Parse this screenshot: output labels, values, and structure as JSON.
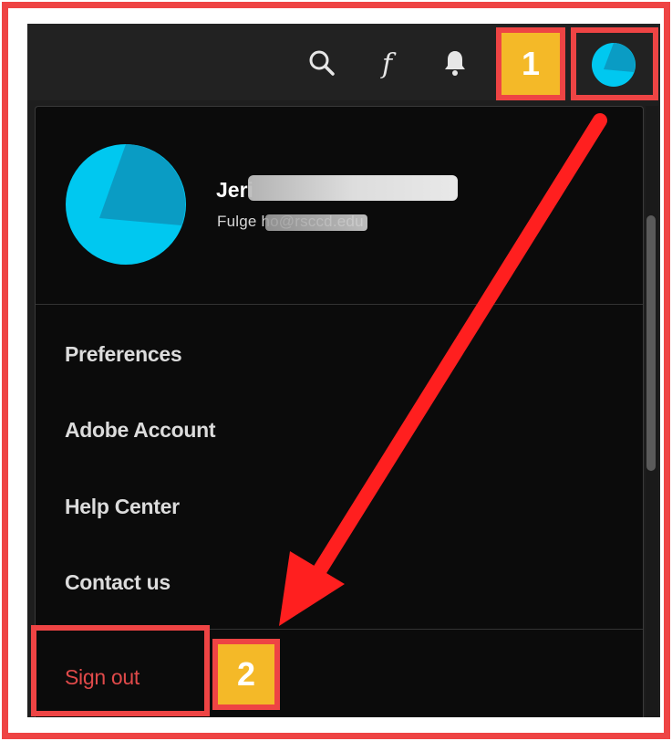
{
  "user": {
    "name": "Jeri",
    "email": "Fulge       ho@rsccd.edu"
  },
  "menu": {
    "items": [
      {
        "label": "Preferences"
      },
      {
        "label": "Adobe Account"
      },
      {
        "label": "Help Center"
      },
      {
        "label": "Contact us"
      }
    ],
    "signout_label": "Sign out"
  },
  "annotations": {
    "step1": "1",
    "step2": "2"
  },
  "toolbar": {
    "icons": [
      "search-icon",
      "font-icon",
      "bell-icon",
      "profile-avatar-icon"
    ]
  },
  "colors": {
    "highlight": "#ee4444",
    "badge": "#f4b928",
    "avatar": "#00c8f0",
    "signout": "#e04a4a",
    "menu_bg": "#0b0b0b"
  }
}
